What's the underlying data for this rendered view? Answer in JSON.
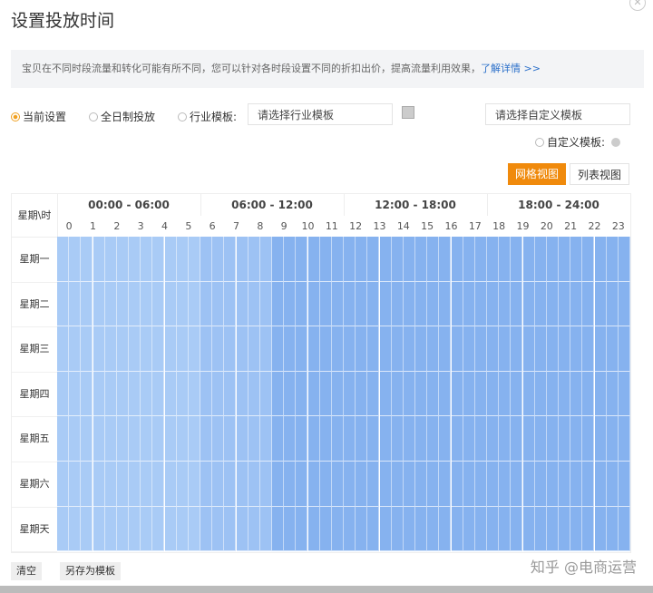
{
  "title": "设置投放时间",
  "notice": {
    "text": "宝贝在不同时段流量和转化可能有所不同，您可以针对各时段设置不同的折扣出价，提高流量利用效果，",
    "link": "了解详情 >>"
  },
  "options": {
    "current": "当前设置",
    "all_day": "全日制投放",
    "industry": "行业模板:",
    "industry_placeholder": "请选择行业模板",
    "custom_placeholder": "请选择自定义模板",
    "custom": "自定义模板:"
  },
  "views": {
    "grid": "网格视图",
    "list": "列表视图"
  },
  "grid": {
    "corner": "星期\\时",
    "ranges": [
      "00:00 - 06:00",
      "06:00 - 12:00",
      "12:00 - 18:00",
      "18:00 - 24:00"
    ],
    "hours": [
      "0",
      "1",
      "2",
      "3",
      "4",
      "5",
      "6",
      "7",
      "8",
      "9",
      "10",
      "11",
      "12",
      "13",
      "14",
      "15",
      "16",
      "17",
      "18",
      "19",
      "20",
      "21",
      "22",
      "23"
    ],
    "days": [
      "星期一",
      "星期二",
      "星期三",
      "星期四",
      "星期五",
      "星期六",
      "星期天"
    ],
    "hour_levels": [
      1,
      1,
      1,
      1,
      1,
      1,
      2,
      2,
      2,
      3,
      3,
      3,
      3,
      3,
      3,
      3,
      3,
      3,
      3,
      3,
      3,
      3,
      3,
      3
    ],
    "level_colors": {
      "1": "#a9cbf6",
      "2": "#9dc2f4",
      "3": "#86b2ef"
    }
  },
  "footer": {
    "clear": "清空",
    "save_template": "另存为模板",
    "watermark": "知乎 @电商运营"
  },
  "accent": "#f08a0c"
}
